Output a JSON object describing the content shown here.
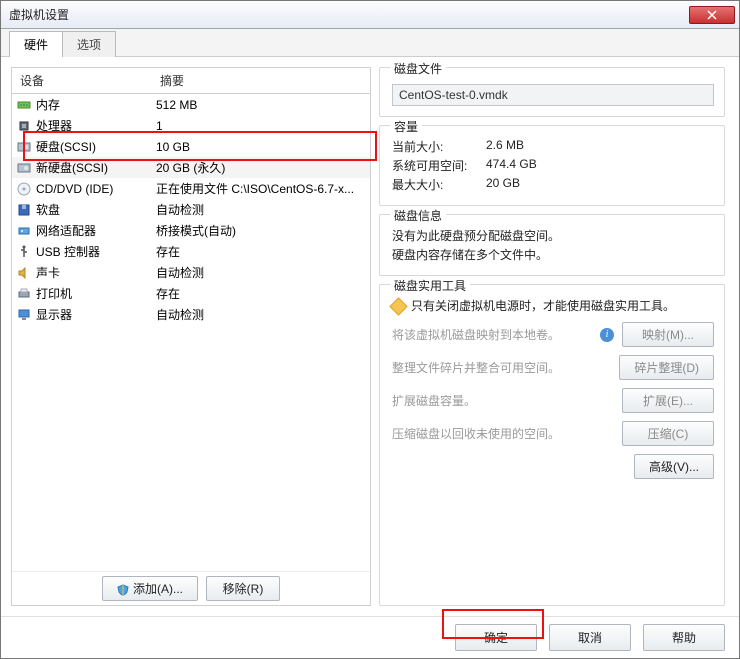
{
  "window": {
    "title": "虚拟机设置"
  },
  "tabs": {
    "hardware": "硬件",
    "options": "选项"
  },
  "hw_header": {
    "device": "设备",
    "summary": "摘要"
  },
  "hw": [
    {
      "icon": "memory-icon",
      "dev": "内存",
      "sum": "512 MB"
    },
    {
      "icon": "cpu-icon",
      "dev": "处理器",
      "sum": "1"
    },
    {
      "icon": "hdd-icon",
      "dev": "硬盘(SCSI)",
      "sum": "10 GB"
    },
    {
      "icon": "hdd-icon",
      "dev": "新硬盘(SCSI)",
      "sum": "20 GB (永久)"
    },
    {
      "icon": "cd-icon",
      "dev": "CD/DVD (IDE)",
      "sum": "正在使用文件 C:\\ISO\\CentOS-6.7-x..."
    },
    {
      "icon": "floppy-icon",
      "dev": "软盘",
      "sum": "自动检测"
    },
    {
      "icon": "net-icon",
      "dev": "网络适配器",
      "sum": "桥接模式(自动)"
    },
    {
      "icon": "usb-icon",
      "dev": "USB 控制器",
      "sum": "存在"
    },
    {
      "icon": "sound-icon",
      "dev": "声卡",
      "sum": "自动检测"
    },
    {
      "icon": "printer-icon",
      "dev": "打印机",
      "sum": "存在"
    },
    {
      "icon": "display-icon",
      "dev": "显示器",
      "sum": "自动检测"
    }
  ],
  "left_buttons": {
    "add": "添加(A)...",
    "remove": "移除(R)"
  },
  "disk_file": {
    "legend": "磁盘文件",
    "path": "CentOS-test-0.vmdk"
  },
  "capacity": {
    "legend": "容量",
    "current_k": "当前大小:",
    "current_v": "2.6 MB",
    "free_k": "系统可用空间:",
    "free_v": "474.4 GB",
    "max_k": "最大大小:",
    "max_v": "20 GB"
  },
  "disk_info": {
    "legend": "磁盘信息",
    "line1": "没有为此硬盘预分配磁盘空间。",
    "line2": "硬盘内容存储在多个文件中。"
  },
  "tools": {
    "legend": "磁盘实用工具",
    "warn": "只有关闭虚拟机电源时，才能使用磁盘实用工具。",
    "map_desc": "将该虚拟机磁盘映射到本地卷。",
    "map_btn": "映射(M)...",
    "defrag_desc": "整理文件碎片并整合可用空间。",
    "defrag_btn": "碎片整理(D)",
    "expand_desc": "扩展磁盘容量。",
    "expand_btn": "扩展(E)...",
    "compress_desc": "压缩磁盘以回收未使用的空间。",
    "compress_btn": "压缩(C)",
    "advanced_btn": "高级(V)..."
  },
  "footer": {
    "ok": "确定",
    "cancel": "取消",
    "help": "帮助"
  }
}
